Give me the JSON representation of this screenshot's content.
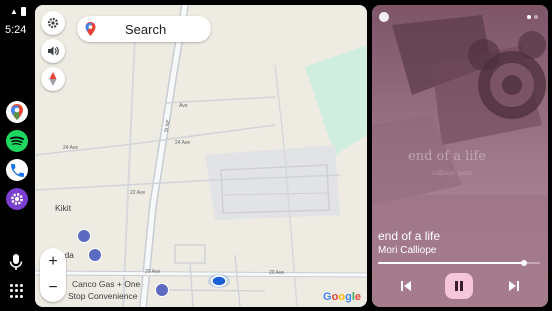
{
  "status": {
    "time": "5:24"
  },
  "rail": {
    "apps": [
      {
        "name": "Google Maps",
        "icon": "maps-icon"
      },
      {
        "name": "Spotify",
        "icon": "spotify-icon"
      },
      {
        "name": "Phone",
        "icon": "phone-icon"
      },
      {
        "name": "Settings",
        "icon": "settings-icon"
      }
    ]
  },
  "map": {
    "search_label": "Search",
    "zoom_in_label": "+",
    "zoom_out_label": "−",
    "places": [
      "Kikit",
      "nada",
      "Canco Gas + One",
      "Stop Convenience"
    ],
    "roads": [
      "24 Ave",
      "24 Ave",
      "22 Ave",
      "20 Ave",
      "20 Ave",
      "Ave",
      "St NE"
    ],
    "attribution": "Google"
  },
  "media": {
    "song": "end of a life",
    "artist": "Mori Calliope",
    "art_text": "end of a life",
    "art_subtext": "calliope mori",
    "progress": 0.9,
    "pager_dots": 2,
    "active_page": 0,
    "play_state": "playing",
    "colors": {
      "accent": "#f6c6d8",
      "card_bg": "#9a7183"
    }
  }
}
